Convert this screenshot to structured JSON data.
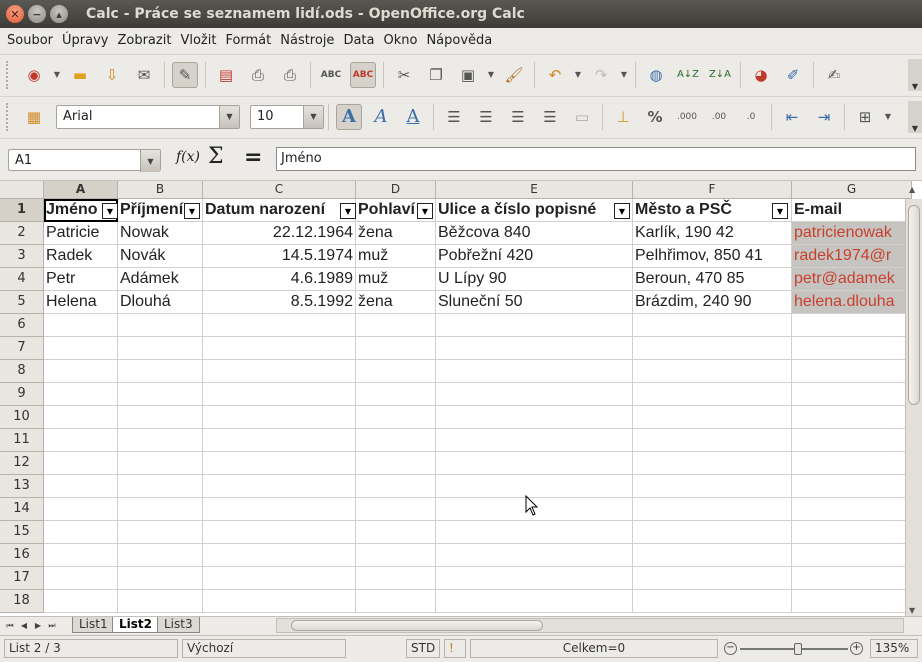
{
  "window": {
    "title": "Calc - Práce se seznamem lidí.ods - OpenOffice.org Calc"
  },
  "menu": [
    "Soubor",
    "Úpravy",
    "Zobrazit",
    "Vložit",
    "Formát",
    "Nástroje",
    "Data",
    "Okno",
    "Nápověda"
  ],
  "format_toolbar": {
    "font_name": "Arial",
    "font_size": "10"
  },
  "formula_bar": {
    "cell_ref": "A1",
    "formula": "Jméno"
  },
  "columns": [
    "A",
    "B",
    "C",
    "D",
    "E",
    "F",
    "G"
  ],
  "rows": [
    "1",
    "2",
    "3",
    "4",
    "5",
    "6",
    "7",
    "8",
    "9",
    "10",
    "11",
    "12",
    "13",
    "14",
    "15",
    "16",
    "17",
    "18"
  ],
  "table": {
    "headers": [
      "Jméno",
      "Příjmení",
      "Datum narození",
      "Pohlaví",
      "Ulice a číslo popisné",
      "Město a PSČ",
      "E-mail"
    ],
    "rows": [
      [
        "Patricie",
        "Nowak",
        "22.12.1964",
        "žena",
        "Běžcova 840",
        "Karlík, 190 42",
        "patricienowak"
      ],
      [
        "Radek",
        "Novák",
        "14.5.1974",
        "muž",
        "Pobřežní 420",
        "Pelhřimov, 850 41",
        "radek1974@r"
      ],
      [
        "Petr",
        "Adámek",
        "4.6.1989",
        "muž",
        "U Lípy 90",
        "Beroun, 470 85",
        "petr@adamek"
      ],
      [
        "Helena",
        "Dlouhá",
        "8.5.1992",
        "žena",
        "Sluneční 50",
        "Brázdim, 240 90",
        "helena.dlouha"
      ]
    ]
  },
  "sheet_tabs": [
    "List1",
    "List2",
    "List3"
  ],
  "active_sheet": "List2",
  "status": {
    "sheet": "List 2 / 3",
    "page_style": "Výchozí",
    "mode": "STD",
    "sum": "Celkem=0",
    "zoom": "135%"
  }
}
